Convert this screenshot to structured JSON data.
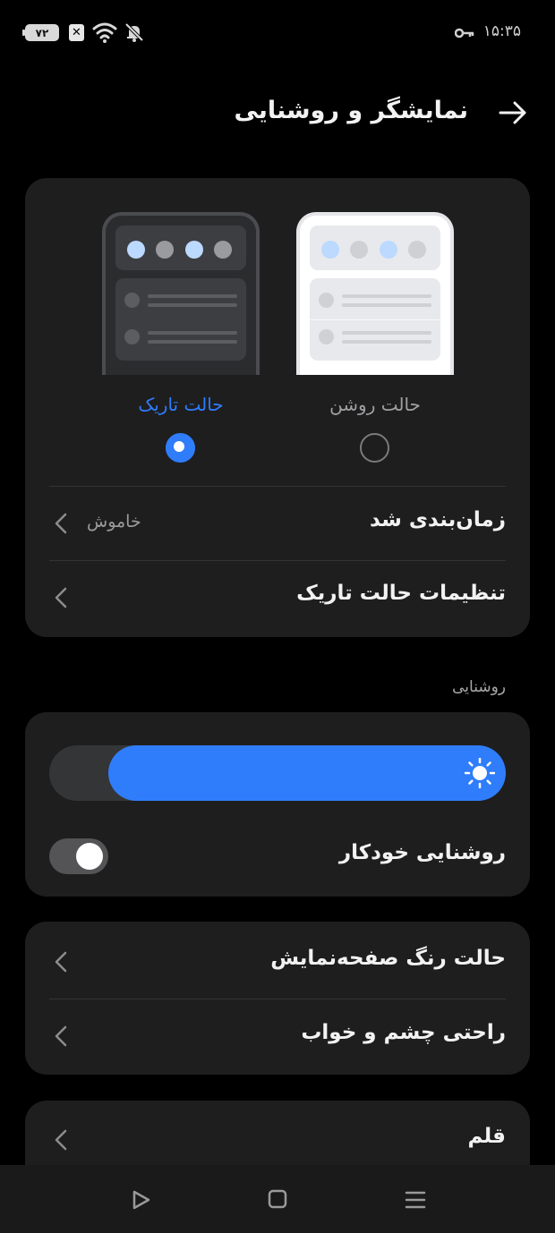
{
  "status_bar": {
    "battery": "۷۲",
    "time": "۱۵:۳۵"
  },
  "header": {
    "title": "نمایشگر و روشنایی"
  },
  "theme": {
    "dark_label": "حالت تاریک",
    "light_label": "حالت روشن",
    "selected": "dark",
    "accent_color": "#2f7dfb"
  },
  "schedule": {
    "label": "زمان‌بندی شد",
    "value": "خاموش"
  },
  "dark_mode_settings": {
    "label": "تنظیمات حالت تاریک"
  },
  "brightness": {
    "section_title": "روشنایی",
    "level": 0.87,
    "auto_label": "روشنایی خودکار",
    "auto_enabled": false
  },
  "display_color": {
    "label": "حالت رنگ صفحه‌نمایش"
  },
  "eye_comfort": {
    "label": "راحتی چشم و خواب"
  },
  "font": {
    "label": "قلم"
  },
  "icons": [
    "battery-icon",
    "sim-error-icon",
    "wifi-icon",
    "mute-notification-icon",
    "vpn-key-icon",
    "back-arrow-icon",
    "chevron-left-icon",
    "sun-icon",
    "play-icon",
    "square-icon",
    "menu-icon"
  ]
}
